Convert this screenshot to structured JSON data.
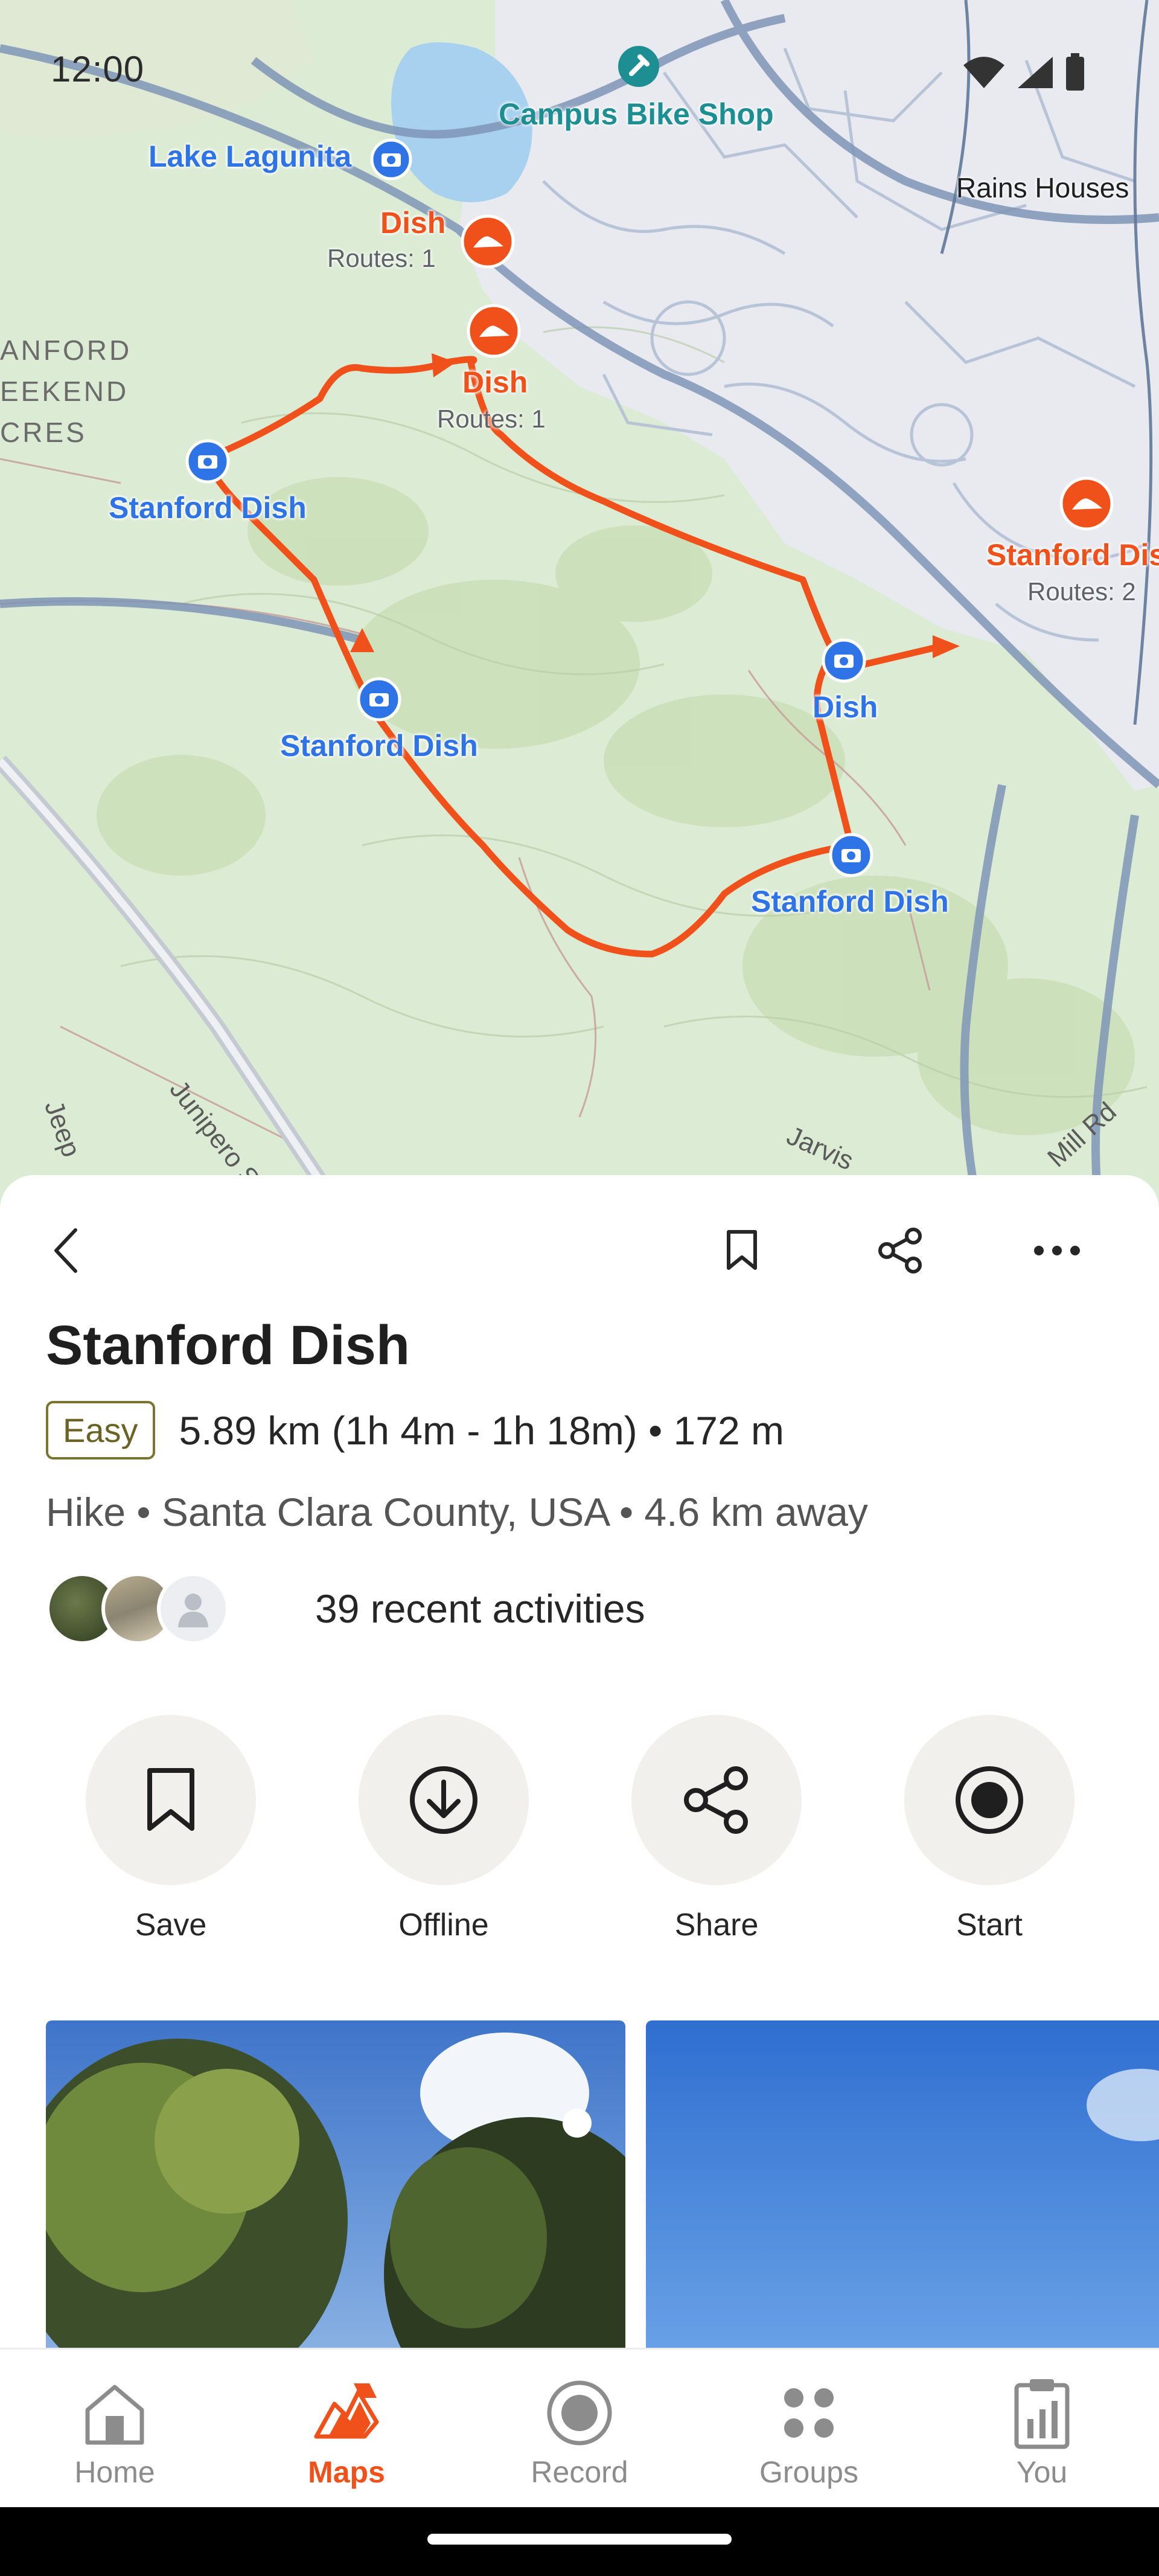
{
  "status_bar": {
    "time": "12:00"
  },
  "map": {
    "labels": {
      "lake_lagunita": "Lake Lagunita",
      "campus_bike_shop": "Campus Bike Shop",
      "rains_houses": "Rains Houses",
      "area_line1": "ANFORD",
      "area_line2": "EEKEND",
      "area_line3": "CRES",
      "dish_1": "Dish",
      "dish_1_routes": "Routes: 1",
      "dish_2": "Dish",
      "dish_2_routes": "Routes: 1",
      "stanford_dish_right": "Stanford Dis",
      "stanford_dish_right_routes": "Routes: 2",
      "stanford_dish_photo_1": "Stanford Dish",
      "stanford_dish_photo_2": "Stanford Dish",
      "stanford_dish_photo_3": "Stanford Dish",
      "dish_photo": "Dish",
      "junipero_serra": "Junipero Serr",
      "jeep": "Jeep",
      "jarvis": "Jarvis",
      "mill_rd": "Mill Rd"
    },
    "route_color": "#F0511A",
    "photo_pin_color": "#2F74E6"
  },
  "route": {
    "title": "Stanford Dish",
    "difficulty": "Easy",
    "stats": "5.89 km (1h 4m - 1h 18m) • 172 m",
    "meta": "Hike • Santa Clara County, USA • 4.6 km away",
    "activities": "39 recent activities"
  },
  "actions": [
    {
      "label": "Save",
      "icon": "bookmark-icon"
    },
    {
      "label": "Offline",
      "icon": "download-icon"
    },
    {
      "label": "Share",
      "icon": "share-icon"
    },
    {
      "label": "Start",
      "icon": "record-icon"
    }
  ],
  "bottom_nav": [
    {
      "label": "Home",
      "icon": "home-icon",
      "active": false
    },
    {
      "label": "Maps",
      "icon": "maps-icon",
      "active": true
    },
    {
      "label": "Record",
      "icon": "record-icon",
      "active": false
    },
    {
      "label": "Groups",
      "icon": "groups-icon",
      "active": false
    },
    {
      "label": "You",
      "icon": "you-icon",
      "active": false
    }
  ],
  "colors": {
    "accent": "#F0511A",
    "badge_border": "#7A7430",
    "action_bg": "#F2F0EC"
  }
}
